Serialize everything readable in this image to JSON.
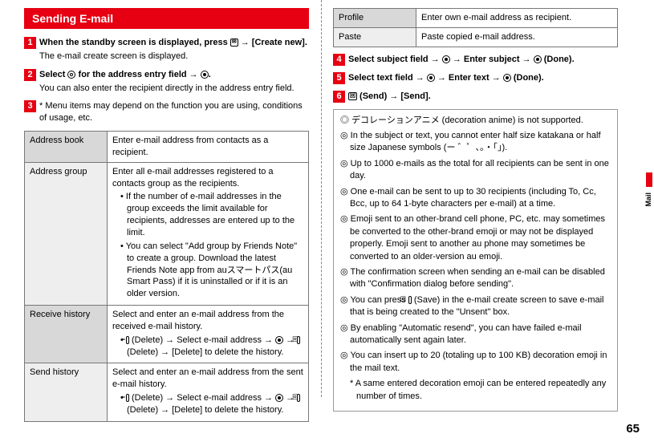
{
  "header": "Sending E-mail",
  "steps_left": {
    "s1": {
      "main": "When the standby screen is displayed, press [mail] → [Create new].",
      "note": "The e-mail create screen is displayed."
    },
    "s2": {
      "main": "Select [cog] for the address entry field → [●].",
      "note": "You can also enter the recipient directly in the address entry field."
    },
    "s3": {
      "main": "* Menu items may depend on the function you are using, conditions of usage, etc."
    }
  },
  "table_left": {
    "rows": [
      {
        "l": "Address book",
        "r": "Enter e-mail address from contacts as a recipient."
      },
      {
        "l": "Address group",
        "r": "Enter all e-mail addresses registered to a contacts group as the recipients."
      },
      {
        "l": "Receive history",
        "r": "Select and enter an e-mail address from the received e-mail history."
      },
      {
        "l": "Send history",
        "r": "Select and enter an e-mail address from the sent e-mail history."
      }
    ],
    "addr_group_list1": "If the number of e-mail addresses in the group exceeds the limit available for recipients, addresses are entered up to the limit.",
    "addr_group_list2": "You can select \"Add group by Friends Note\" to create a group. Download the latest Friends Note app from auスマートパス(au Smart Pass) if it is uninstalled or if it is an older version.",
    "recv_hist_bullet": "[Del] (Delete) → Select e-mail address → [●] → [Opt] (Delete) → [Delete] to delete the history.",
    "send_hist_bullet": "[Del] (Delete) → Select e-mail address → [●] → [Opt] (Delete) → [Delete] to delete the history."
  },
  "table_right": {
    "profile_l": "Profile",
    "profile_r": "Enter own e-mail address as recipient.",
    "paste_l": "Paste",
    "paste_r": "Paste copied e-mail address."
  },
  "steps_right": {
    "s4": "Select subject field → [●] → Enter subject → [●] (Done).",
    "s5": "Select text field → [●] → Enter text → [●] (Done).",
    "s6": "[Opt] (Send) → [Send]."
  },
  "notes": {
    "n1": "デコレーションアニメ (decoration anime) is not supported.",
    "n2": "In the subject or text, you cannot enter half size katakana or half size Japanese symbols (ー ゛゜、。・「」).",
    "n3": "Up to 1000 e-mails as the total for all recipients can be sent in one day.",
    "n4": "One e-mail can be sent to up to 30 recipients (including To, Cc, Bcc, up to 64 1-byte characters per e-mail) at a time.",
    "n5": "Emoji sent to an other-brand cell phone, PC, etc. may sometimes be converted to the other-brand emoji or may not be displayed properly. Emoji sent to another au phone may sometimes be converted to an older-version au emoji.",
    "n6": "The confirmation screen when sending an e-mail can be disabled with \"Confirmation dialog before sending\".",
    "n7": "You can press [Save] (Save) in the e-mail create screen to save e-mail that is being created to the \"Unsent\" box.",
    "n8": "By enabling \"Automatic resend\", you can have failed e-mail automatically sent again later.",
    "n9": "You can insert up to 20 (totaling up to 100 KB) decoration emoji in the mail text.",
    "n9a": "* A same entered decoration emoji can be entered repeatedly any number of times."
  },
  "side_tab": "Mail",
  "page_num": "65"
}
